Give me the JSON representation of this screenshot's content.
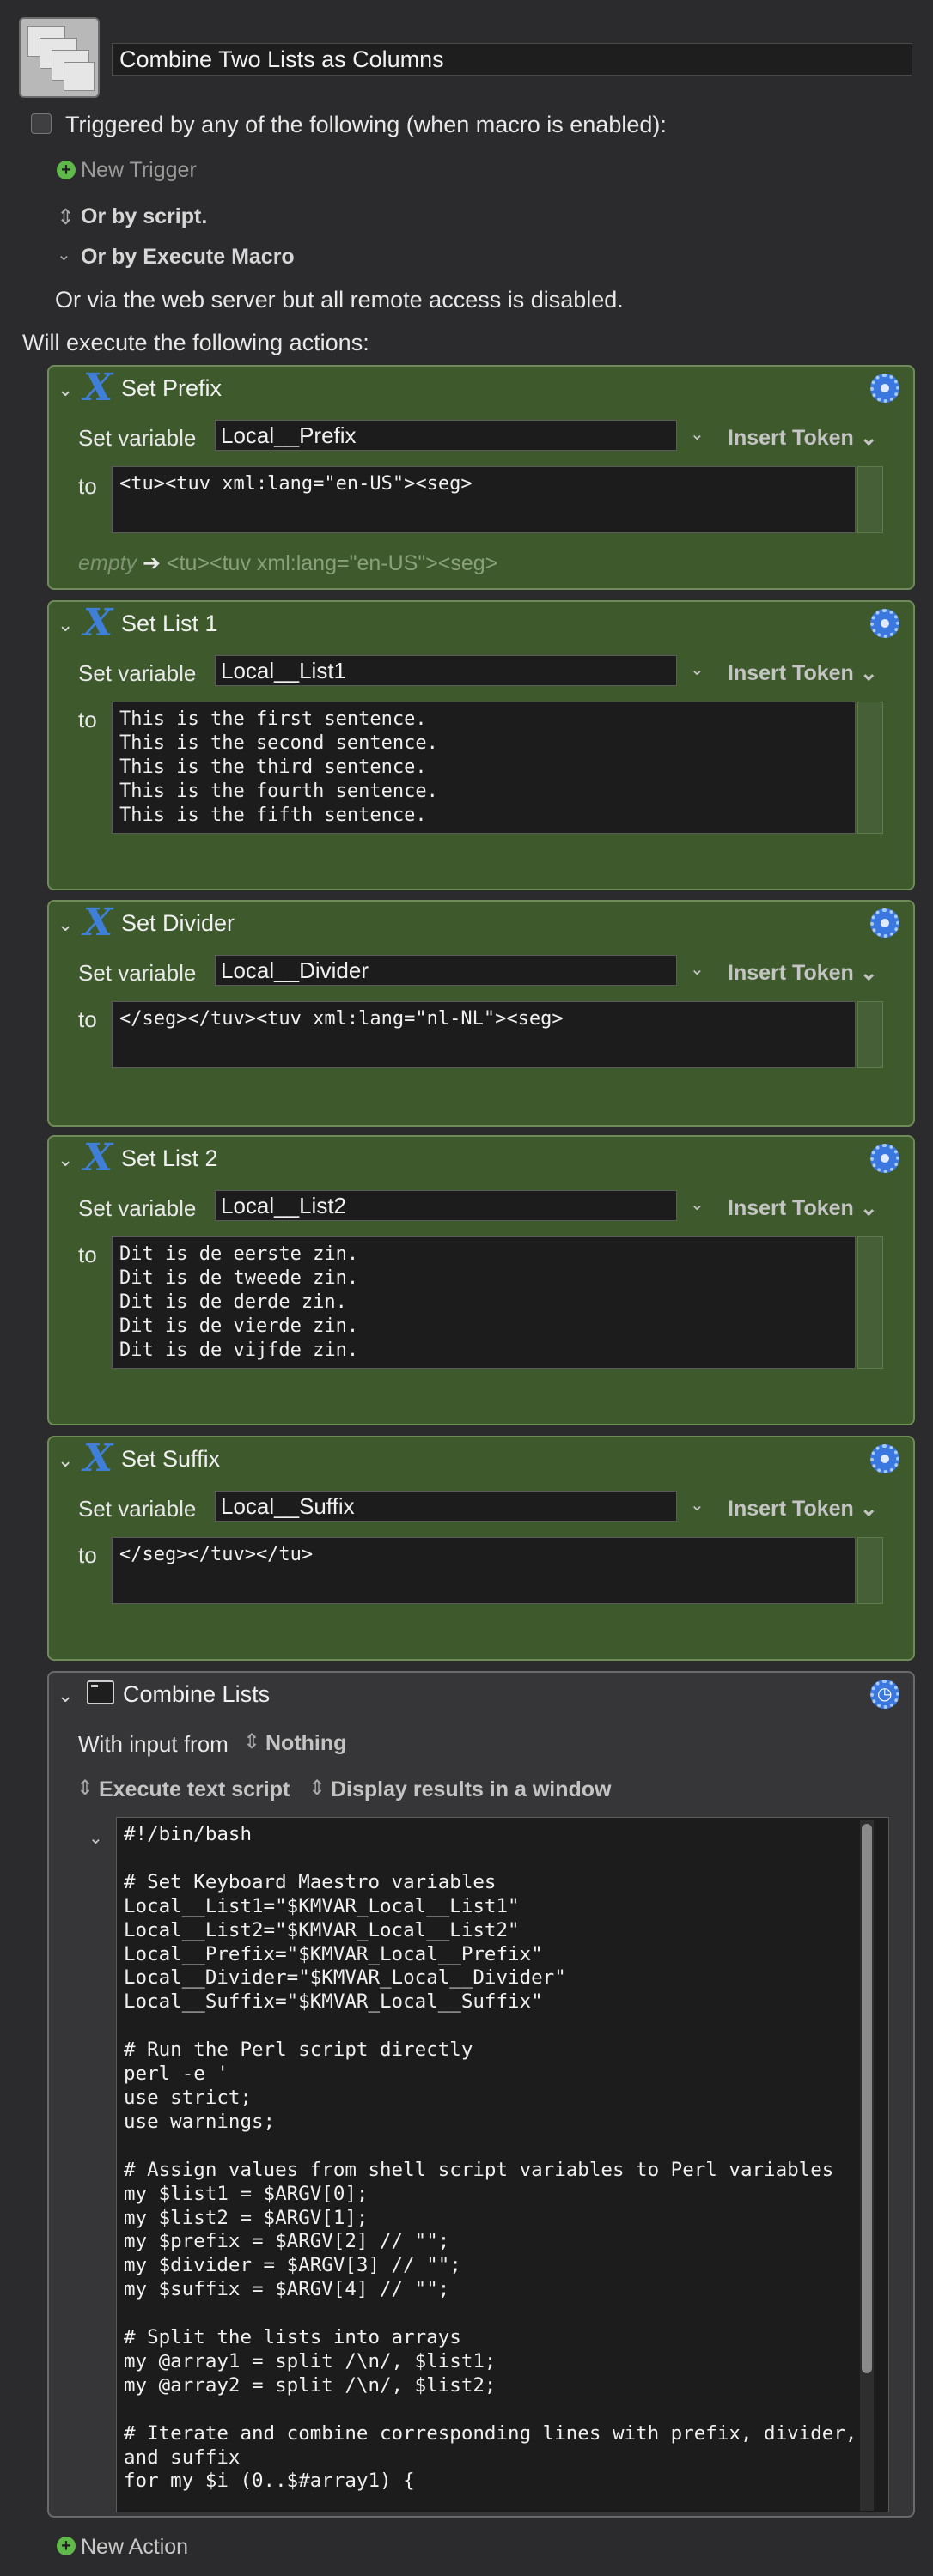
{
  "macro": {
    "name": "Combine Two Lists as Columns",
    "trigger_label": "Triggered by any of the following (when macro is enabled):",
    "new_trigger": "New Trigger",
    "or_by_script": "Or by script.",
    "or_by_execute_macro": "Or by Execute Macro",
    "web_server_note": "Or via the web server but all remote access is disabled.",
    "will_execute": "Will execute the following actions:",
    "new_action": "New Action"
  },
  "common": {
    "set_variable": "Set variable",
    "to": "to",
    "insert_token": "Insert Token"
  },
  "actions": [
    {
      "title": "Set Prefix",
      "variable": "Local__Prefix",
      "value": "<tu><tuv xml:lang=\"en-US\"><seg>",
      "preview_empty": "empty",
      "preview_value": "<tu><tuv xml:lang=\"en-US\"><seg>"
    },
    {
      "title": "Set List 1",
      "variable": "Local__List1",
      "value": "This is the first sentence.\nThis is the second sentence.\nThis is the third sentence.\nThis is the fourth sentence.\nThis is the fifth sentence."
    },
    {
      "title": "Set Divider",
      "variable": "Local__Divider",
      "value": "</seg></tuv><tuv xml:lang=\"nl-NL\"><seg>"
    },
    {
      "title": "Set List 2",
      "variable": "Local__List2",
      "value": "Dit is de eerste zin.\nDit is de tweede zin.\nDit is de derde zin.\nDit is de vierde zin.\nDit is de vijfde zin."
    },
    {
      "title": "Set Suffix",
      "variable": "Local__Suffix",
      "value": "</seg></tuv></tu>"
    }
  ],
  "combine": {
    "title": "Combine Lists",
    "with_input_label": "With input from",
    "input_value": "Nothing",
    "execute_mode": "Execute text script",
    "display_mode": "Display results in a window",
    "script": "#!/bin/bash\n\n# Set Keyboard Maestro variables\nLocal__List1=\"$KMVAR_Local__List1\"\nLocal__List2=\"$KMVAR_Local__List2\"\nLocal__Prefix=\"$KMVAR_Local__Prefix\"\nLocal__Divider=\"$KMVAR_Local__Divider\"\nLocal__Suffix=\"$KMVAR_Local__Suffix\"\n\n# Run the Perl script directly\nperl -e '\nuse strict;\nuse warnings;\n\n# Assign values from shell script variables to Perl variables\nmy $list1 = $ARGV[0];\nmy $list2 = $ARGV[1];\nmy $prefix = $ARGV[2] // \"\";\nmy $divider = $ARGV[3] // \"\";\nmy $suffix = $ARGV[4] // \"\";\n\n# Split the lists into arrays\nmy @array1 = split /\\n/, $list1;\nmy @array2 = split /\\n/, $list2;\n\n# Iterate and combine corresponding lines with prefix, divider, and suffix\nfor my $i (0..$#array1) {"
  },
  "colors": {
    "background": "#2b2b2d",
    "action_green": "#3e5a2d",
    "action_border": "#6f8c58",
    "shell_action": "#363638",
    "accent_blue": "#3a78e0",
    "add_green": "#5fb84a"
  },
  "icons": {
    "macro": "macro-windows-icon",
    "variable": "variable-x-icon",
    "shell": "terminal-icon",
    "gear": "gear-icon",
    "add": "plus-circle-icon"
  }
}
